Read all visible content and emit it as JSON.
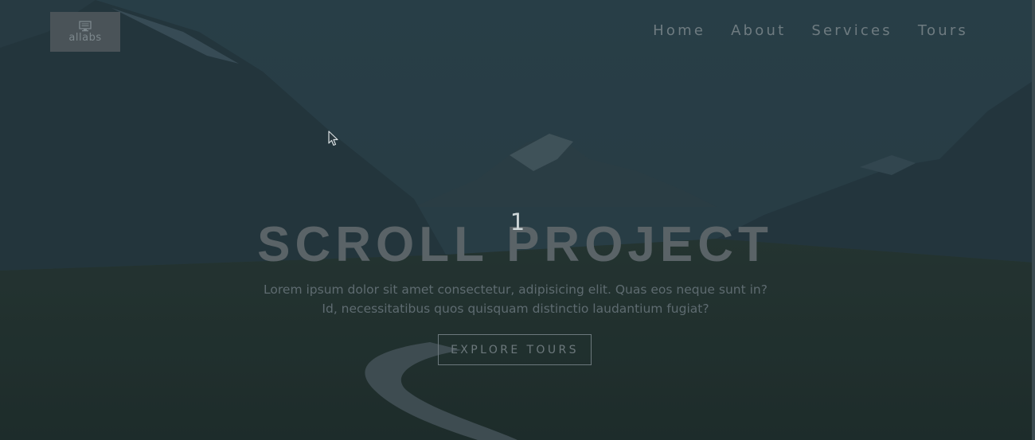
{
  "header": {
    "logo_text": "allabs",
    "logo_icon": "monitor-icon",
    "nav": [
      {
        "label": "Home"
      },
      {
        "label": "About"
      },
      {
        "label": "Services"
      },
      {
        "label": "Tours"
      }
    ]
  },
  "hero": {
    "counter": "1",
    "title": "SCROLL PROJECT",
    "subtitle": "Lorem ipsum dolor sit amet consectetur, adipisicing elit. Quas eos neque sunt in? Id, necessitatibus quos quisquam distinctio laudantium fugiat?",
    "cta_label": "EXPLORE TOURS",
    "background": "mountain-valley-photo"
  },
  "colors": {
    "overlay": "#223e48",
    "nav_text": "#6e7b80",
    "title_text": "#5a6367",
    "counter_text": "#cdd6d8"
  }
}
